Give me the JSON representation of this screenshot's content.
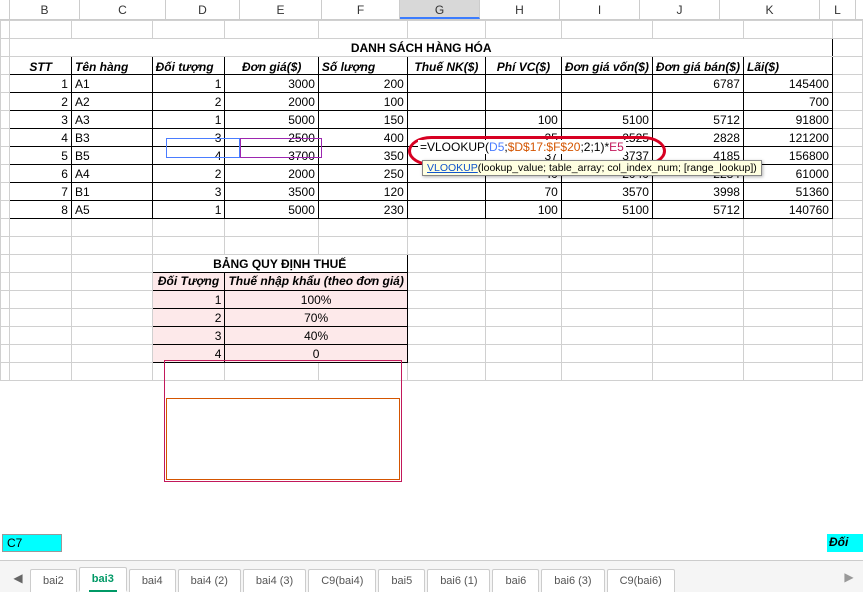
{
  "columns": [
    "B",
    "C",
    "D",
    "E",
    "F",
    "G",
    "H",
    "I",
    "J",
    "K",
    "L"
  ],
  "active_col": "G",
  "title_main": "DANH SÁCH HÀNG HÓA",
  "headers": {
    "stt": "STT",
    "ten": "Tên hàng",
    "doi": "Đối tượng",
    "don": "Đơn giá($)",
    "sl": "Số lượng",
    "thue": "Thuế NK($)",
    "phi": "Phí VC($)",
    "dgv": "Đơn giá vốn($)",
    "dgb": "Đơn giá bán($)",
    "lai": "Lãi($)"
  },
  "rows": [
    {
      "stt": "1",
      "ten": "A1",
      "doi": "1",
      "don": "3000",
      "sl": "200",
      "thue": "",
      "phi": "",
      "dgv": "",
      "dgb": "6787",
      "lai": "145400"
    },
    {
      "stt": "2",
      "ten": "A2",
      "doi": "2",
      "don": "2000",
      "sl": "100",
      "thue": "",
      "phi": "",
      "dgv": "",
      "dgb": "",
      "lai": "700"
    },
    {
      "stt": "3",
      "ten": "A3",
      "doi": "1",
      "don": "5000",
      "sl": "150",
      "thue": "",
      "phi": "100",
      "dgv": "5100",
      "dgb": "5712",
      "lai": "91800"
    },
    {
      "stt": "4",
      "ten": "B3",
      "doi": "3",
      "don": "2500",
      "sl": "400",
      "thue": "",
      "phi": "25",
      "dgv": "2525",
      "dgb": "2828",
      "lai": "121200"
    },
    {
      "stt": "5",
      "ten": "B5",
      "doi": "4",
      "don": "3700",
      "sl": "350",
      "thue": "",
      "phi": "37",
      "dgv": "3737",
      "dgb": "4185",
      "lai": "156800"
    },
    {
      "stt": "6",
      "ten": "A4",
      "doi": "2",
      "don": "2000",
      "sl": "250",
      "thue": "",
      "phi": "40",
      "dgv": "2040",
      "dgb": "2284",
      "lai": "61000"
    },
    {
      "stt": "7",
      "ten": "B1",
      "doi": "3",
      "don": "3500",
      "sl": "120",
      "thue": "",
      "phi": "70",
      "dgv": "3570",
      "dgb": "3998",
      "lai": "51360"
    },
    {
      "stt": "8",
      "ten": "A5",
      "doi": "1",
      "don": "5000",
      "sl": "230",
      "thue": "",
      "phi": "100",
      "dgv": "5100",
      "dgb": "5712",
      "lai": "140760"
    }
  ],
  "tax_title": "BẢNG QUY ĐỊNH THUẾ",
  "tax_headers": {
    "doi": "Đối Tượng",
    "thue": "Thuế nhập khẩu (theo đơn giá)"
  },
  "tax_rows": [
    {
      "doi": "1",
      "thue": "100%"
    },
    {
      "doi": "2",
      "thue": "70%"
    },
    {
      "doi": "3",
      "thue": "40%"
    },
    {
      "doi": "4",
      "thue": "0"
    }
  ],
  "name_box": "C7",
  "right_label": "Đối tư",
  "formula": {
    "prefix": "=VLOOKUP(",
    "arg1": "D5",
    "sep1": ";",
    "arg2": "$D$17:$F$20",
    "sep2": ";2;1)*",
    "arg3": "E5"
  },
  "tooltip": {
    "fn": "VLOOKUP",
    "rest": "(lookup_value; table_array; col_index_num; [range_lookup])"
  },
  "tabs": [
    "bai2",
    "bai3",
    "bai4",
    "bai4 (2)",
    "bai4 (3)",
    "C9(bai4)",
    "bai5",
    "bai6 (1)",
    "bai6",
    "bai6 (3)",
    "C9(bai6)"
  ],
  "active_tab": "bai3"
}
